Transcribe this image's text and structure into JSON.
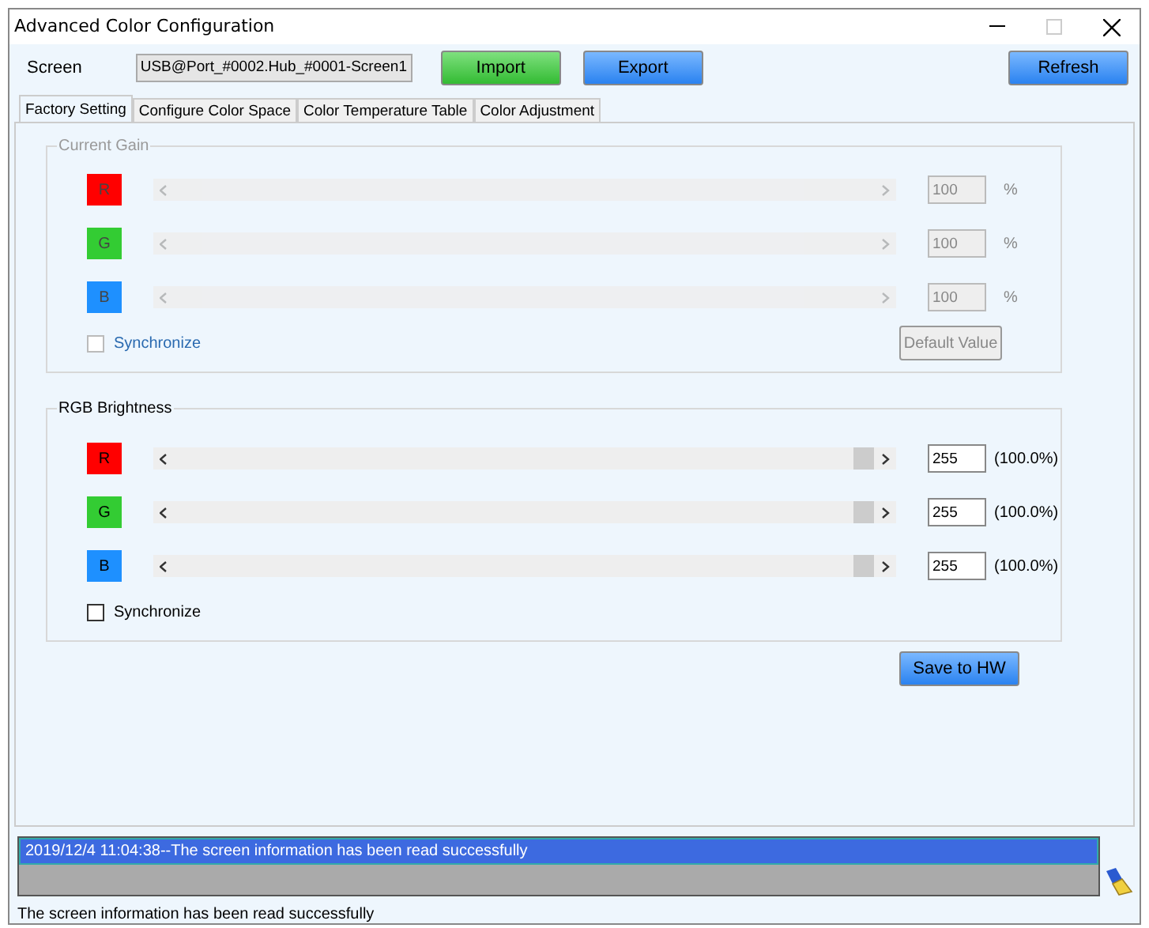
{
  "window": {
    "title": "Advanced Color Configuration"
  },
  "toolbar": {
    "screen_label": "Screen",
    "screen_value": "USB@Port_#0002.Hub_#0001-Screen1",
    "buttons": [
      {
        "label": "Import",
        "kind": "green"
      },
      {
        "label": "Export",
        "kind": "blue"
      },
      {
        "label": "Refresh",
        "kind": "blue"
      }
    ]
  },
  "tabs": [
    {
      "label": "Factory Setting",
      "selected": true
    },
    {
      "label": "Configure Color Space",
      "selected": false
    },
    {
      "label": "Color Temperature Table",
      "selected": false
    },
    {
      "label": "Color Adjustment",
      "selected": false
    }
  ],
  "groups": [
    {
      "title": "Current Gain",
      "disabled": true,
      "channels": [
        {
          "label": "R",
          "color": "#ff0000",
          "value": "100",
          "unit": "%"
        },
        {
          "label": "G",
          "color": "#33cc33",
          "value": "100",
          "unit": "%"
        },
        {
          "label": "B",
          "color": "#1e90ff",
          "value": "100",
          "unit": "%"
        }
      ],
      "synchronize": {
        "label": "Synchronize",
        "checked": false
      },
      "button": {
        "label": "Default Value",
        "disabled": true
      }
    },
    {
      "title": "RGB Brightness",
      "disabled": false,
      "channels": [
        {
          "label": "R",
          "color": "#ff0000",
          "value": "255",
          "unit": "(100.0%)",
          "level": 1
        },
        {
          "label": "G",
          "color": "#33cc33",
          "value": "255",
          "unit": "(100.0%)",
          "level": 1
        },
        {
          "label": "B",
          "color": "#1e90ff",
          "value": "255",
          "unit": "(100.0%)",
          "level": 1
        }
      ],
      "synchronize": {
        "label": "Synchronize",
        "checked": false
      }
    }
  ],
  "save_button": {
    "label": "Save to HW"
  },
  "log": [
    {
      "text": "2019/12/4 11:04:38--The screen information has been read successfully",
      "selected": true
    }
  ],
  "status_bar": "The screen information has been read successfully"
}
